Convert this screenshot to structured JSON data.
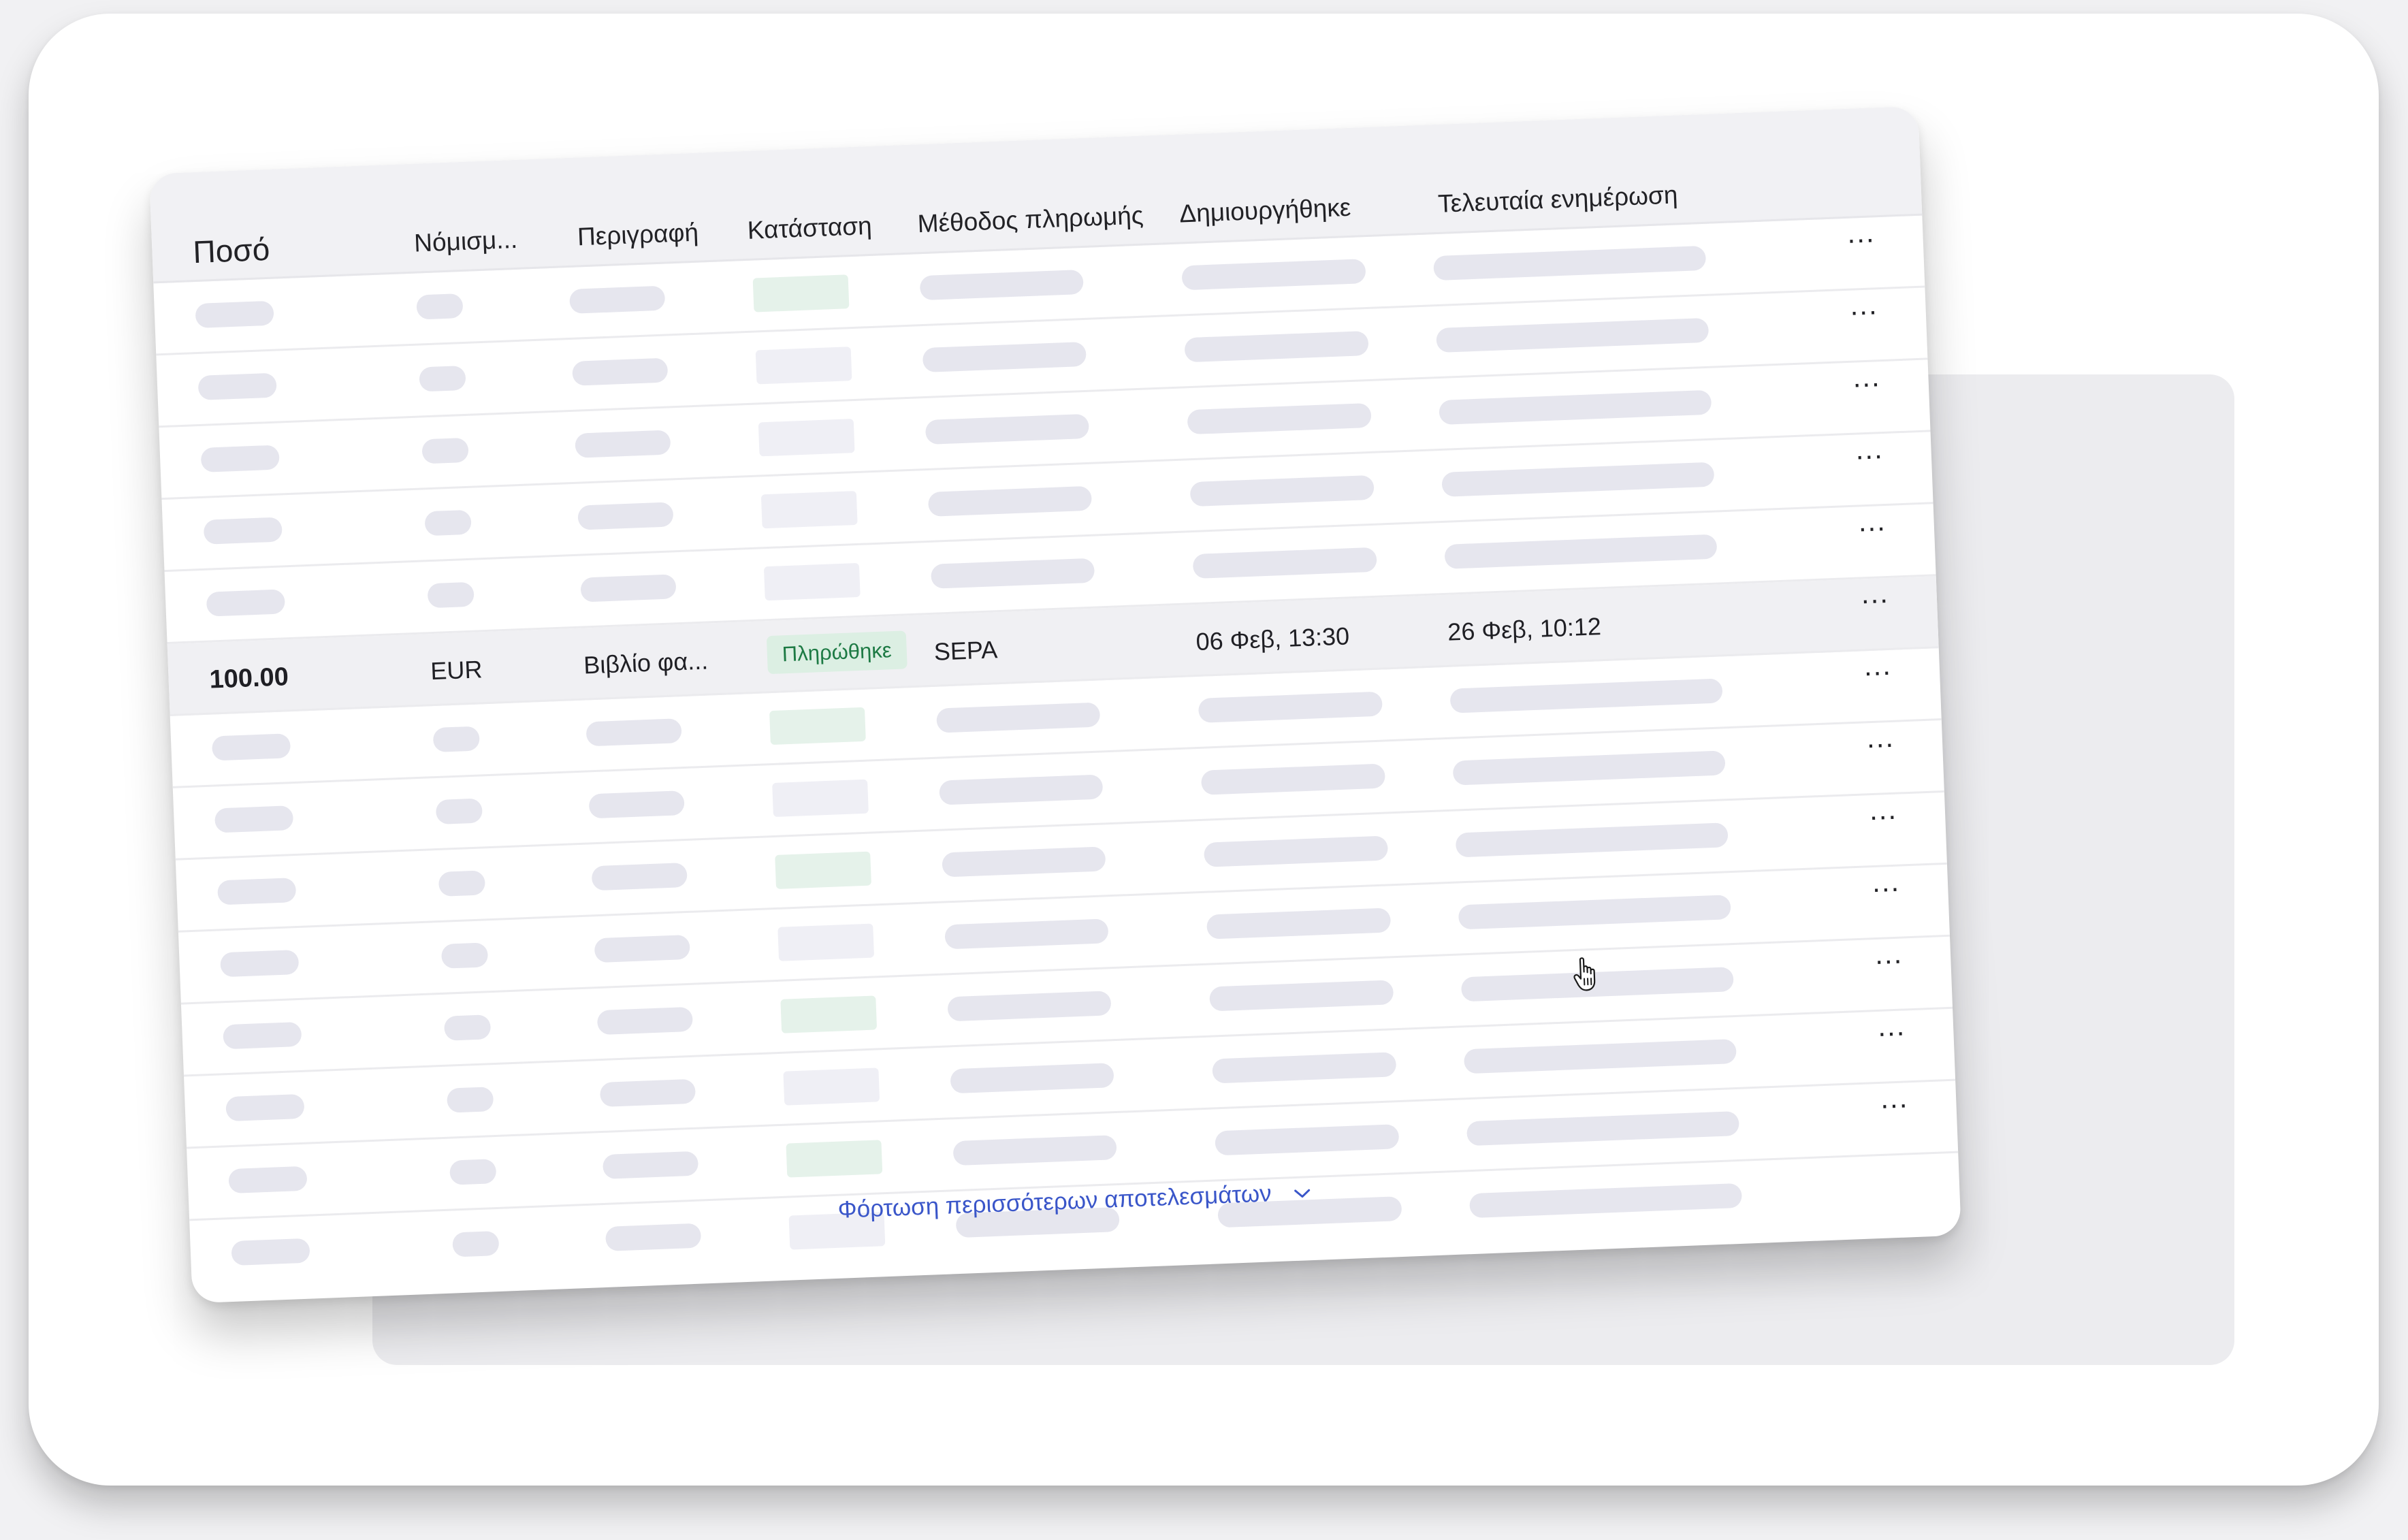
{
  "table": {
    "columns": [
      "Ποσό",
      "Νόμισμ...",
      "Περιγραφή",
      "Κατάσταση",
      "Μέθοδος πληρωμής",
      "Δημιουργήθηκε",
      "Τελευταία ενημέρωση"
    ],
    "highlighted_row": {
      "amount": "100.00",
      "currency": "EUR",
      "description": "Βιβλίο φα...",
      "status": "Πληρώθηκε",
      "payment_method": "SEPA",
      "created": "06 Φεβ, 13:30",
      "updated": "26 Φεβ, 10:12"
    },
    "row_menu_label": "..."
  },
  "footer": {
    "load_more_label": "Φόρτωση περισσότερων αποτελεσμάτων"
  },
  "colors": {
    "accent_link": "#3a56c9",
    "paid_badge_bg": "#dcefe3",
    "paid_badge_text": "#1d7a44",
    "skeleton": "#e6e6ee"
  },
  "icons": {
    "row_menu": "more-horizontal-icon",
    "load_more": "chevron-down-icon",
    "cursor": "hand-pointer-icon"
  }
}
